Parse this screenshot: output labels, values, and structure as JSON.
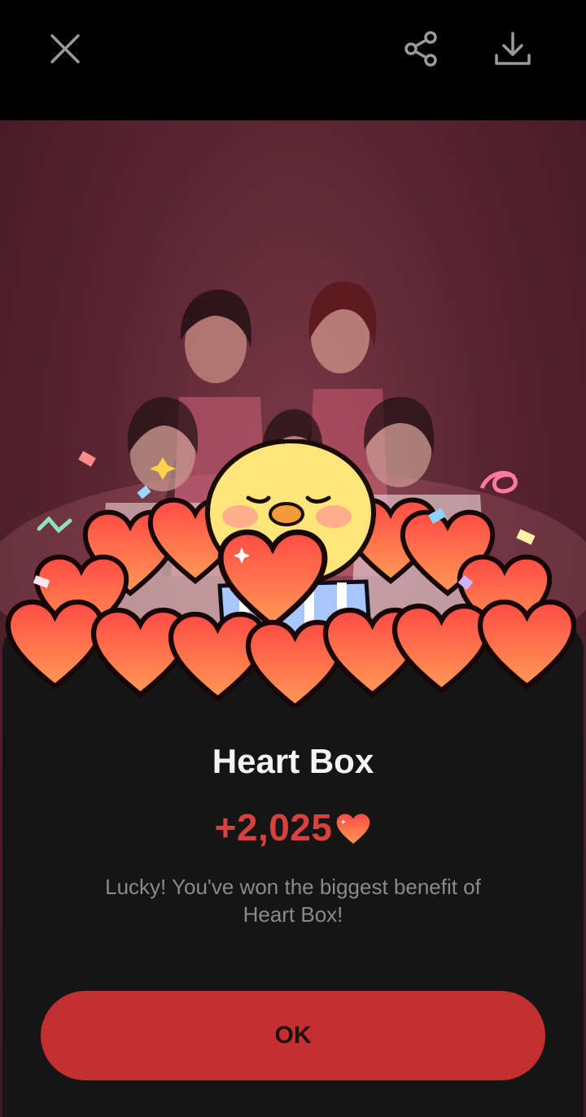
{
  "topbar": {
    "close_icon": "close-icon",
    "share_icon": "share-icon",
    "download_icon": "download-icon"
  },
  "dialog": {
    "title": "Heart Box",
    "reward_amount": "+2,025",
    "reward_icon": "heart-icon",
    "description": "Lucky! You've won the biggest benefit of Heart Box!",
    "ok_label": "OK"
  },
  "colors": {
    "accent": "#c42f2f",
    "reward_text": "#d9413f",
    "sheet_background": "#151515"
  }
}
